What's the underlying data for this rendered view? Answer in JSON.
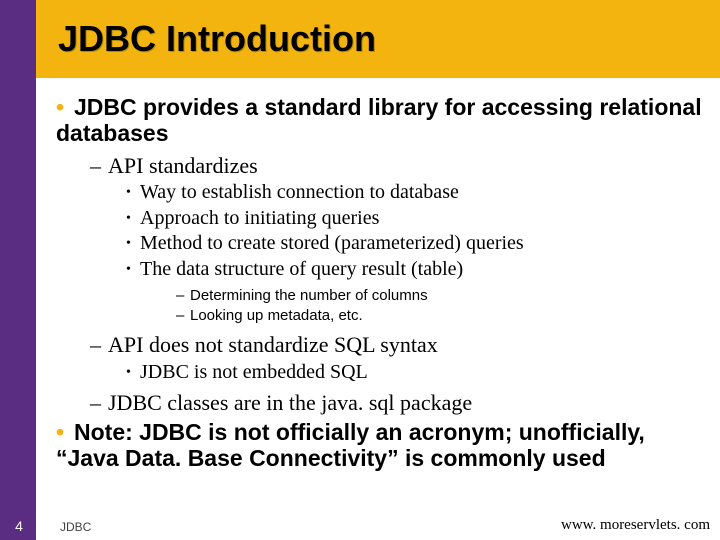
{
  "title": "JDBC Introduction",
  "p1": "JDBC provides a standard library for accessing relational databases",
  "p2": "API standardizes",
  "p2_items": {
    "a": "Way to establish connection to database",
    "b": "Approach to initiating queries",
    "c": "Method to create stored (parameterized) queries",
    "d": "The data structure of query result (table)"
  },
  "p2d_sub": {
    "a": "Determining the number of columns",
    "b": "Looking up metadata, etc."
  },
  "p3": "API does not standardize SQL syntax",
  "p3_items": {
    "a": "JDBC is not embedded SQL"
  },
  "p4": "JDBC classes are in the java. sql package",
  "note": "Note: JDBC is not officially an acronym; unofficially, “Java Data. Base Connectivity” is commonly used",
  "footer": {
    "page": "4",
    "left": "JDBC",
    "right": "www. moreservlets. com"
  }
}
